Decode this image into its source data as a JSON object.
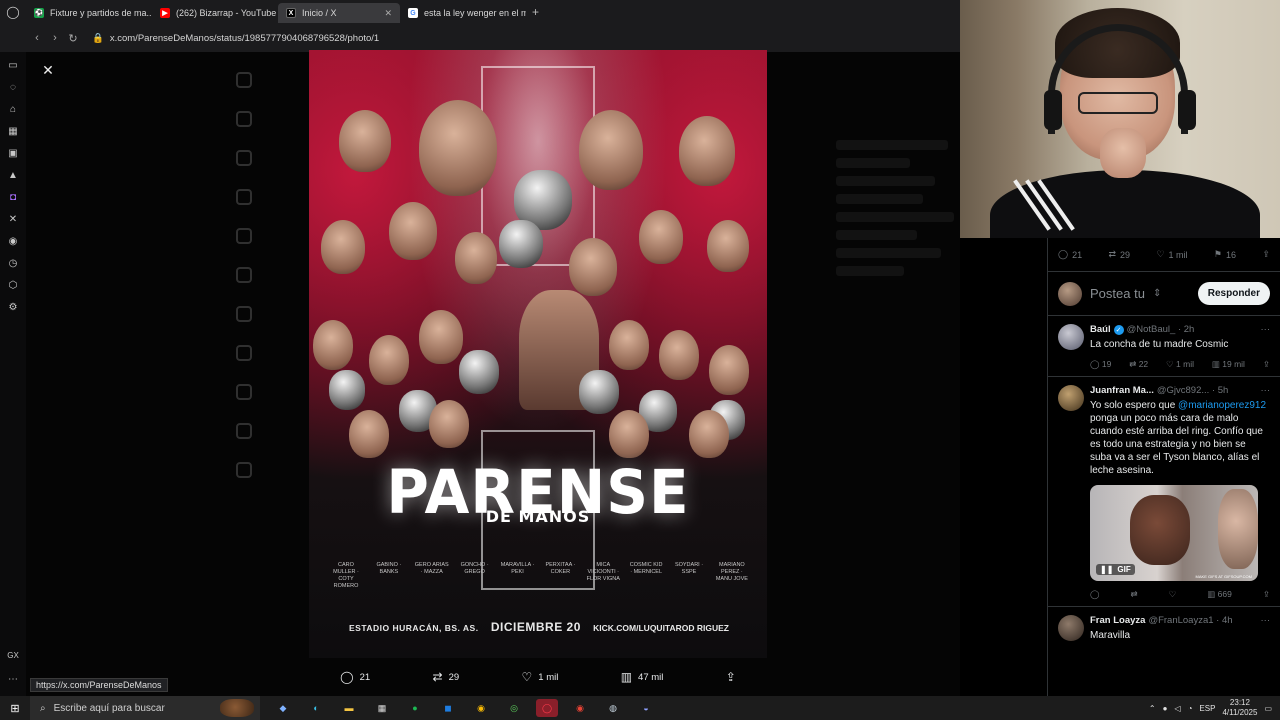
{
  "browser": {
    "tabs": [
      {
        "label": "Fixture y partidos de ma...",
        "fav": "F",
        "color": "#16a34a",
        "active": false
      },
      {
        "label": "(262) Bizarrap - YouTube",
        "fav": "▶",
        "color": "#ff0000",
        "active": false
      },
      {
        "label": "Inicio / X",
        "fav": "X",
        "color": "#000000",
        "active": true
      },
      {
        "label": "esta la ley wenger en el m",
        "fav": "G",
        "color": "#ffffff",
        "active": false
      }
    ],
    "url": "x.com/ParenseDeManos/status/1985777904068796528/photo/1",
    "status_link": "https://x.com/ParenseDeManos"
  },
  "poster": {
    "title": "PARENSE",
    "subtitle": "DE MANOS",
    "fighters": [
      "CARO MULLER · COTY ROMERO",
      "GABINO · BANKS",
      "GERO ARIAS · MAZZA",
      "GONCHO · GREGO",
      "MARAVILLA · PEKI",
      "PERXITAA · COKER",
      "MICA VICIOONTI · FLOR VIGNA",
      "COSMIC KID · MERNICEL",
      "SOYDARI · SSPE",
      "MARIANO PEREZ · MANU JOVE"
    ],
    "venue": "ESTADIO HURACÁN, BS. AS.",
    "date": "DICIEMBRE 20",
    "link": "KICK.COM/LUQUITAROD RIGUEZ"
  },
  "poster_actions": {
    "replies": "21",
    "reposts": "29",
    "likes": "1 mil",
    "views": "47 mil"
  },
  "panel": {
    "stats": {
      "replies": "21",
      "reposts": "29",
      "likes": "1 mil",
      "bookmarks": "16"
    },
    "reply_placeholder": "Postea tu",
    "reply_button": "Responder",
    "tweets": [
      {
        "name": "Baúl",
        "verified": true,
        "handle": "@NotBaul_ · 2h",
        "text": "La concha de tu madre Cosmic",
        "replies": "19",
        "reposts": "22",
        "likes": "1 mil",
        "views": "19 mil"
      },
      {
        "name": "Juanfran Ma...",
        "verified": false,
        "handle": "@Gjvc892... · 5h",
        "text_pre": "Yo solo espero que ",
        "mention": "@marianoperez912",
        "text_post": " ponga un poco más cara de malo cuando esté arriba del ring. Confío que es todo una estrategia y no bien se suba va a ser el Tyson blanco, alías el leche asesina.",
        "gif_label": "GIF",
        "gif_credit": "MAKE GIFS AT GIFSOUP.COM",
        "replies": "",
        "reposts": "",
        "likes": "",
        "views": "669"
      },
      {
        "name": "Fran Loayza",
        "verified": false,
        "handle": "@FranLoayza1 · 4h",
        "text": "Maravilla"
      }
    ]
  },
  "taskbar": {
    "search_placeholder": "Escribe aquí para buscar",
    "lang": "ESP",
    "time": "23:12",
    "date": "4/11/2025"
  }
}
